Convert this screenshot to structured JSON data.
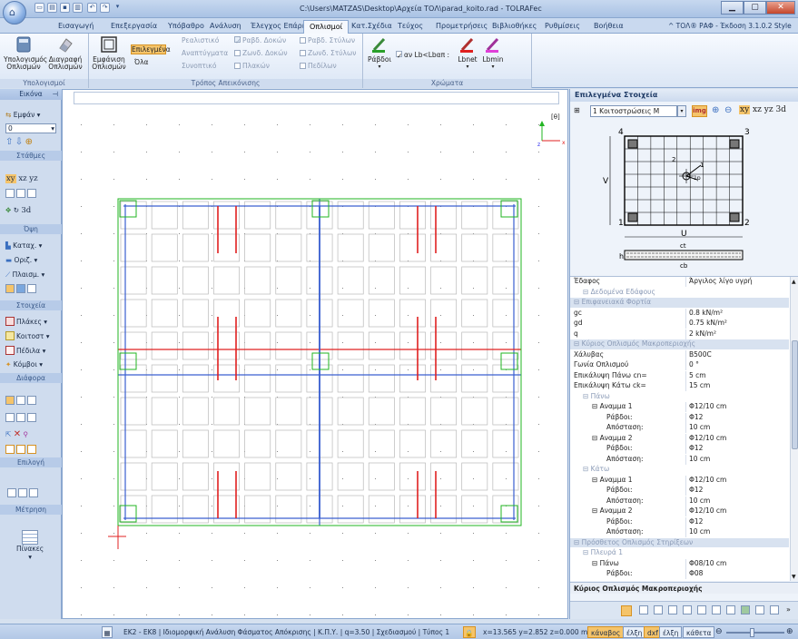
{
  "titlebar": {
    "title": "C:\\Users\\MATZAS\\Desktop\\Αρχεία ΤΟΛ\\parad_koito.rad - TOLRAFec"
  },
  "tabs": [
    "Εισαγωγή",
    "Επεξεργασία",
    "Υπόβαθρο",
    "Ανάλυση",
    "Έλεγχος Επάρκ",
    "Οπλισμοί",
    "Κατ.Σχέδια",
    "Τεύχος",
    "Προμετρήσεις",
    "Βιβλιοθήκες",
    "Ρυθμίσεις",
    "Βοήθεια"
  ],
  "version_label": "^ ΤΟΛ® ΡΑΦ - Έκδοση 3.1.0.2   Style",
  "ribbon": {
    "calc_label": "Υπολογισμός Οπλισμών",
    "delete_label": "Διαγραφή Οπλισμών",
    "group_calc": "Υπολογισμοί",
    "show_label": "Εμφάνιση Οπλισμών",
    "selected_label": "Επιλεγμένα",
    "all_label": "Όλα",
    "realistic": "Ρεαλιστικό",
    "developed": "Αναπτύγματα",
    "schematic": "Συνοπτικό",
    "chk_rods_beams": "Ραβδ. Δοκών",
    "chk_zones_beams": "Ζωνδ. Δοκών",
    "chk_slabs": "Πλακών",
    "chk_rods_cols": "Ραβδ. Στύλων",
    "chk_zones_cols": "Ζωνδ. Στύλων",
    "chk_fnd": "Πεδίλων",
    "group_view": "Τρόπος Απεικόνισης",
    "rods_label": "Ράβδοι",
    "lb_label": "αν Lb<Lbαπ :",
    "lbnet_label": "Lbnet",
    "lbmin_label": "Lbmin",
    "group_colors": "Χρώματα"
  },
  "left": {
    "header": "Εικόνα",
    "show_btn": "Εμφάν",
    "level_value": "0",
    "sec_levels": "Στάθμες",
    "xy": "xy",
    "xz": "xz",
    "yz": "yz",
    "d3": "3d",
    "sec_view": "Όψη",
    "katak": "Καταχ.",
    "oriz": "Οριζ.",
    "plasm": "Πλαισμ.",
    "sec_elements": "Στοιχεία",
    "plakes": "Πλάκες",
    "koitost": "Κοιτοστ",
    "pedila": "Πέδιλα",
    "kombi": "Κόμβοι",
    "sec_various": "Διάφορα",
    "sec_select": "Επιλογή",
    "sec_measure": "Μέτρηση",
    "tables": "Πίνακες"
  },
  "drawing": {
    "theta_label": "[θ]",
    "z_axis": "z",
    "x_axis": "x"
  },
  "right": {
    "header": "Επιλεγμένα Στοιχεία",
    "dropdown": "1 Κοιτοστρώσεις Μ",
    "img_btn": "img",
    "xy": "xy",
    "xz": "xz",
    "yz": "yz",
    "d3": "3d",
    "corner1": "1",
    "corner2": "2",
    "corner3": "3",
    "corner4": "4",
    "label_U": "U",
    "label_V": "V",
    "label_h": "h",
    "label_ct": "ct",
    "label_cb": "cb",
    "label_2": "2",
    "label_1": "1",
    "label_lp": "1p",
    "props": [
      {
        "k": "Έδαφος",
        "v": "Άργιλος λίγο υγρή",
        "type": "row",
        "indent": 0
      },
      {
        "k": "Δεδομένα Εδάφους",
        "v": "",
        "type": "sub",
        "indent": 1
      },
      {
        "k": "Επιφανειακά Φορτία",
        "v": "",
        "type": "cat",
        "indent": 0
      },
      {
        "k": "gc",
        "v": "0.8 kN/m²",
        "type": "row",
        "indent": 0
      },
      {
        "k": "gd",
        "v": "0.75 kN/m²",
        "type": "row",
        "indent": 0
      },
      {
        "k": "q",
        "v": "2 kN/m²",
        "type": "row",
        "indent": 0
      },
      {
        "k": "Κύριος Οπλισμός Μακροπεριοχής",
        "v": "",
        "type": "cat",
        "indent": 0
      },
      {
        "k": "Χάλυβας",
        "v": "B500C",
        "type": "row",
        "indent": 0
      },
      {
        "k": "Γωνία Οπλισμού",
        "v": "0 °",
        "type": "row",
        "indent": 0
      },
      {
        "k": "Επικάλυψη Πάνω cn=",
        "v": "5 cm",
        "type": "row",
        "indent": 0
      },
      {
        "k": "Επικάλυψη Κάτω ck=",
        "v": "15 cm",
        "type": "row",
        "indent": 0
      },
      {
        "k": "Πάνω",
        "v": "",
        "type": "sub",
        "indent": 1
      },
      {
        "k": "Αναμμα 1",
        "v": "Φ12/10 cm",
        "type": "row",
        "indent": 2
      },
      {
        "k": "Ράβδοι:",
        "v": "Φ12",
        "type": "row",
        "indent": 3
      },
      {
        "k": "Απόσταση:",
        "v": "10 cm",
        "type": "row",
        "indent": 3
      },
      {
        "k": "Αναμμα 2",
        "v": "Φ12/10 cm",
        "type": "row",
        "indent": 2
      },
      {
        "k": "Ράβδοι:",
        "v": "Φ12",
        "type": "row",
        "indent": 3
      },
      {
        "k": "Απόσταση:",
        "v": "10 cm",
        "type": "row",
        "indent": 3
      },
      {
        "k": "Κάτω",
        "v": "",
        "type": "sub",
        "indent": 1
      },
      {
        "k": "Αναμμα 1",
        "v": "Φ12/10 cm",
        "type": "row",
        "indent": 2
      },
      {
        "k": "Ράβδοι:",
        "v": "Φ12",
        "type": "row",
        "indent": 3
      },
      {
        "k": "Απόσταση:",
        "v": "10 cm",
        "type": "row",
        "indent": 3
      },
      {
        "k": "Αναμμα 2",
        "v": "Φ12/10 cm",
        "type": "row",
        "indent": 2
      },
      {
        "k": "Ράβδοι:",
        "v": "Φ12",
        "type": "row",
        "indent": 3
      },
      {
        "k": "Απόσταση:",
        "v": "10 cm",
        "type": "row",
        "indent": 3
      },
      {
        "k": "Πρόσθετος Οπλισμός Στηρίξεων",
        "v": "",
        "type": "cat",
        "indent": 0
      },
      {
        "k": "Πλευρά 1",
        "v": "",
        "type": "sub",
        "indent": 1
      },
      {
        "k": "Πάνω",
        "v": "Φ08/10 cm",
        "type": "row",
        "indent": 2
      },
      {
        "k": "Ράβδοι:",
        "v": "Φ08",
        "type": "row",
        "indent": 3
      }
    ],
    "footer_title": "Κύριος Οπλισμός Μακροπεριοχής"
  },
  "status": {
    "code_text": "ΕΚ2 - ΕΚ8 | Ιδιομορφική Ανάλυση Φάσματος Απόκρισης | Κ.Π.Υ. | q=3.50 | Σχεδιασμού | Τύπος 1",
    "coords": "x=13.565 y=2.852 z=0.000 m",
    "kanabos": "κάναβος",
    "elxi": "έλξη",
    "dxf": "dxf",
    "elxi2": "έλξη",
    "katheta": "κάθετα"
  },
  "colors": {
    "accent": "#f0a030",
    "ribbon_blue": "#c9d9ef"
  }
}
